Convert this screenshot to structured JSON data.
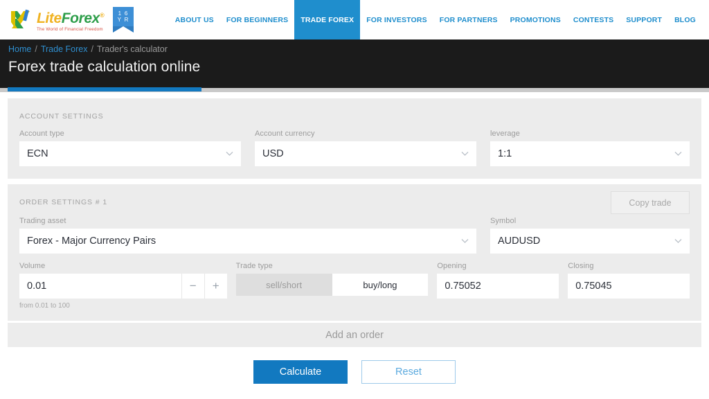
{
  "brand": {
    "name_part1": "Lite",
    "name_part2": "Forex",
    "registered_mark": "®",
    "tagline": "The World of Financial Freedom",
    "anniversary_badge_line1": "1 6",
    "anniversary_badge_line2": "Y R",
    "accent_blue": "#1f8ecd",
    "logo_green": "#2e9e4a",
    "logo_yellow": "#f0b323",
    "tagline_red": "#d64b3d"
  },
  "nav": {
    "items": [
      {
        "label": "ABOUT US",
        "active": false
      },
      {
        "label": "FOR BEGINNERS",
        "active": false
      },
      {
        "label": "TRADE FOREX",
        "active": true
      },
      {
        "label": "FOR INVESTORS",
        "active": false
      },
      {
        "label": "FOR PARTNERS",
        "active": false
      },
      {
        "label": "PROMOTIONS",
        "active": false
      },
      {
        "label": "CONTESTS",
        "active": false
      },
      {
        "label": "SUPPORT",
        "active": false
      },
      {
        "label": "BLOG",
        "active": false
      }
    ]
  },
  "breadcrumb": {
    "home": "Home",
    "sep1": "/",
    "trade_forex": "Trade Forex",
    "sep2": "/",
    "current": "Trader's calculator"
  },
  "page_title": "Forex trade calculation online",
  "account_settings": {
    "caption": "ACCOUNT SETTINGS",
    "account_type": {
      "label": "Account type",
      "value": "ECN"
    },
    "account_currency": {
      "label": "Account currency",
      "value": "USD"
    },
    "leverage": {
      "label": "leverage",
      "value": "1:1"
    }
  },
  "order_settings": {
    "caption": "ORDER SETTINGS # 1",
    "copy_trade_label": "Copy trade",
    "trading_asset": {
      "label": "Trading asset",
      "value": "Forex - Major Currency Pairs"
    },
    "symbol": {
      "label": "Symbol",
      "value": "AUDUSD"
    },
    "volume": {
      "label": "Volume",
      "value": "0.01",
      "hint": "from 0.01 to 100",
      "decrement": "−",
      "increment": "+"
    },
    "trade_type": {
      "label": "Trade type",
      "sell": "sell/short",
      "buy": "buy/long",
      "selected": "buy/long"
    },
    "opening": {
      "label": "Opening",
      "value": "0.75052"
    },
    "closing": {
      "label": "Closing",
      "value": "0.75045"
    }
  },
  "add_order_label": "Add an order",
  "actions": {
    "calculate": "Calculate",
    "reset": "Reset"
  }
}
